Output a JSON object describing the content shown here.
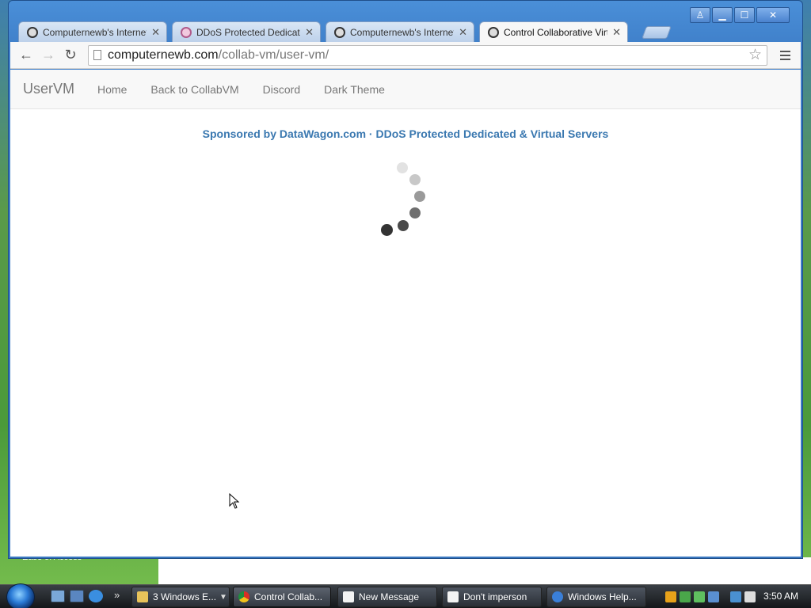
{
  "window_controls": {
    "user": "♙",
    "minimize": "▁",
    "maximize": "☐",
    "close": "✕"
  },
  "tabs": [
    {
      "title": "Computernewb's Internet",
      "icon": "computernewb-icon"
    },
    {
      "title": "DDoS Protected Dedicated",
      "icon": "datawagon-icon"
    },
    {
      "title": "Computernewb's Internet",
      "icon": "computernewb-icon"
    },
    {
      "title": "Control Collaborative Virt",
      "icon": "computernewb-icon",
      "active": true
    }
  ],
  "tab_close_glyph": "✕",
  "toolbar": {
    "back_glyph": "←",
    "forward_glyph": "→",
    "reload_glyph": "↻",
    "star_glyph": "☆"
  },
  "address_bar": {
    "host": "computernewb.com",
    "path": "/collab-vm/user-vm/"
  },
  "navbar": {
    "brand": "UserVM",
    "links": [
      "Home",
      "Back to CollabVM",
      "Discord",
      "Dark Theme"
    ]
  },
  "sponsor_text": "Sponsored by DataWagon.com · DDoS Protected Dedicated & Virtual Servers",
  "desktop": {
    "behind_window_label": "Ease of Access"
  },
  "taskbar": {
    "tasks": [
      {
        "label": "3 Windows E...",
        "icon": "folder-icon",
        "has_arrow": true
      },
      {
        "label": "Control Collab...",
        "icon": "chrome-icon",
        "active": true
      },
      {
        "label": "New Message",
        "icon": "document-icon"
      },
      {
        "label": "Don't imperson",
        "icon": "document-icon"
      },
      {
        "label": "Windows Help...",
        "icon": "help-icon"
      }
    ],
    "quick_launch_more": "»",
    "clock": "3:50 AM"
  },
  "colors": {
    "accent_link": "#3a78b0",
    "nav_text": "#777777",
    "titlebar_blue": "#4a8fd8"
  }
}
